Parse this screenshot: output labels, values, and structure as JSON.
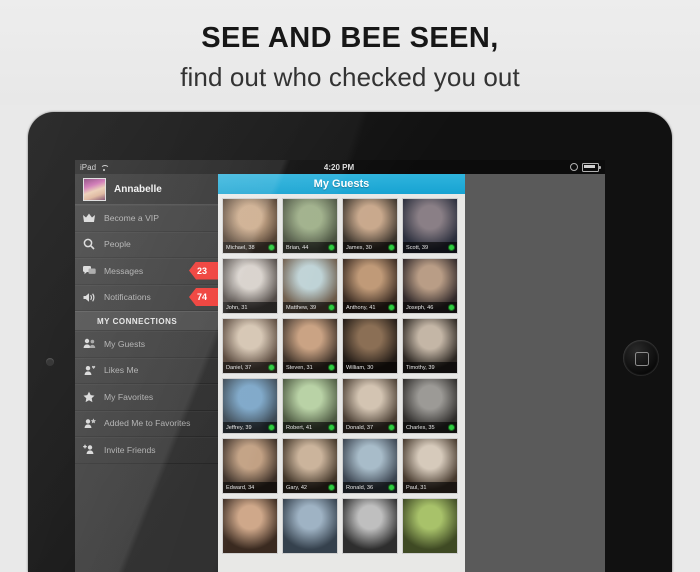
{
  "headline": {
    "line1": "SEE AND BEE SEEN,",
    "line2": "find out who checked you out"
  },
  "device": {
    "home_button_icon": "rounded-square-icon",
    "camera_icon": "front-camera-icon"
  },
  "statusbar": {
    "carrier": "iPad",
    "wifi_icon": "wifi-icon",
    "time": "4:20 PM",
    "gear_icon": "gear-icon",
    "battery_icon": "battery-icon"
  },
  "sidebar": {
    "profile": {
      "name": "Annabelle",
      "avatar_icon": "user-avatar"
    },
    "items": [
      {
        "label": "Become a VIP",
        "icon": "crown-icon",
        "badge": "",
        "selected": false
      },
      {
        "label": "People",
        "icon": "search-icon",
        "badge": "",
        "selected": false
      },
      {
        "label": "Messages",
        "icon": "messages-icon",
        "badge": "23",
        "selected": false
      },
      {
        "label": "Notifications",
        "icon": "megaphone-icon",
        "badge": "74",
        "selected": false
      }
    ],
    "section_title": "MY CONNECTIONS",
    "connections": [
      {
        "label": "My Guests",
        "icon": "two-people-icon",
        "selected": true
      },
      {
        "label": "Likes Me",
        "icon": "heart-person-icon",
        "selected": false
      },
      {
        "label": "My Favorites",
        "icon": "star-icon",
        "selected": false
      },
      {
        "label": "Added Me to Favorites",
        "icon": "person-star-icon",
        "selected": false
      },
      {
        "label": "Invite Friends",
        "icon": "add-person-icon",
        "selected": false
      }
    ]
  },
  "panel": {
    "title": "My Guests",
    "accent_color": "#17a3d2",
    "online_dot_color": "#2ecc40",
    "badge_color": "#ee2a24",
    "guests": [
      {
        "caption": "Michael, 38",
        "online": true,
        "c1": "#caa887",
        "c2": "#4c3a2b"
      },
      {
        "caption": "Brian, 44",
        "online": true,
        "c1": "#9fb08a",
        "c2": "#4a5240"
      },
      {
        "caption": "James, 30",
        "online": true,
        "c1": "#c9a98d",
        "c2": "#3b342c"
      },
      {
        "caption": "Scott, 39",
        "online": true,
        "c1": "#8a7f86",
        "c2": "#2b2f3d"
      },
      {
        "caption": "John, 31",
        "online": false,
        "c1": "#d8d2cc",
        "c2": "#4b4440"
      },
      {
        "caption": "Matthew, 39",
        "online": true,
        "c1": "#bfd3d6",
        "c2": "#6c5a48"
      },
      {
        "caption": "Anthony, 41",
        "online": true,
        "c1": "#c09a78",
        "c2": "#3a2b22"
      },
      {
        "caption": "Joseph, 46",
        "online": true,
        "c1": "#b99d86",
        "c2": "#31292a"
      },
      {
        "caption": "Daniel, 37",
        "online": true,
        "c1": "#d6c6b3",
        "c2": "#554438"
      },
      {
        "caption": "Steven, 31",
        "online": true,
        "c1": "#caa384",
        "c2": "#3d3128"
      },
      {
        "caption": "William, 30",
        "online": false,
        "c1": "#8b6f55",
        "c2": "#221b16"
      },
      {
        "caption": "Timothy, 39",
        "online": false,
        "c1": "#c4b6a6",
        "c2": "#2c2722"
      },
      {
        "caption": "Jeffrey, 39",
        "online": true,
        "c1": "#7ea8c9",
        "c2": "#3d4a55"
      },
      {
        "caption": "Robert, 41",
        "online": true,
        "c1": "#b9d2a6",
        "c2": "#4e5a42"
      },
      {
        "caption": "Donald, 37",
        "online": true,
        "c1": "#d3c4b2",
        "c2": "#4a3e33"
      },
      {
        "caption": "Charles, 35",
        "online": true,
        "c1": "#9c9a96",
        "c2": "#2f2d2b"
      },
      {
        "caption": "Edward, 34",
        "online": false,
        "c1": "#c2a184",
        "c2": "#3a2e26"
      },
      {
        "caption": "Gary, 42",
        "online": true,
        "c1": "#cbb49c",
        "c2": "#413528"
      },
      {
        "caption": "Ronald, 36",
        "online": true,
        "c1": "#a8bcc9",
        "c2": "#3b4450"
      },
      {
        "caption": "Paul, 31",
        "online": false,
        "c1": "#d6cabb",
        "c2": "#46392d"
      },
      {
        "caption": "",
        "online": false,
        "c1": "#cfa88a",
        "c2": "#3a2a20"
      },
      {
        "caption": "",
        "online": false,
        "c1": "#9fb3c4",
        "c2": "#35414d"
      },
      {
        "caption": "",
        "online": false,
        "c1": "#bfbfbf",
        "c2": "#2e2e2e"
      },
      {
        "caption": "",
        "online": false,
        "c1": "#a8c26a",
        "c2": "#3f4a24"
      }
    ]
  }
}
